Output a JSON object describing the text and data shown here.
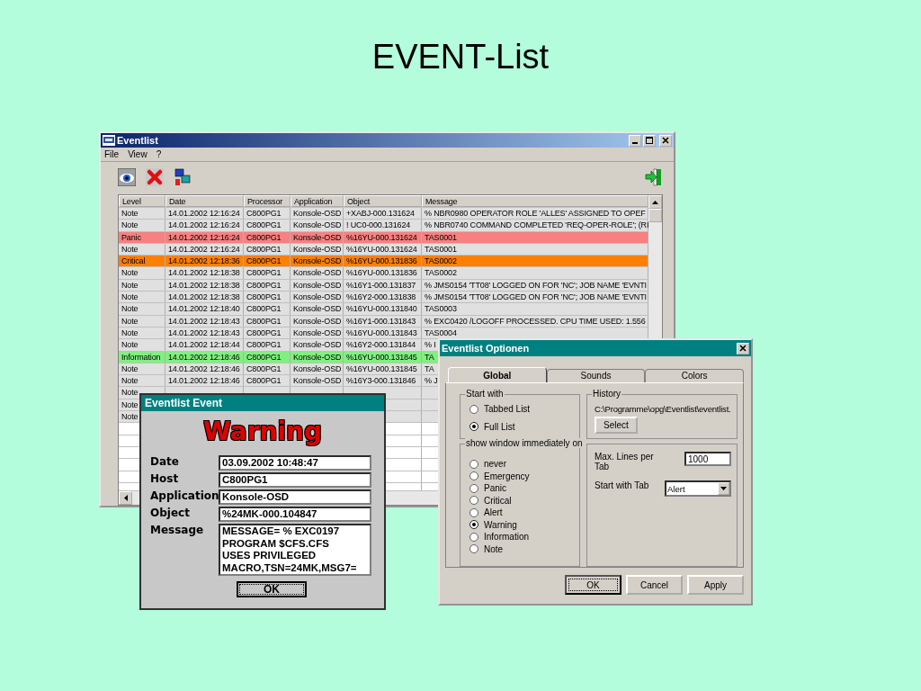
{
  "slide_title": "EVENT-List",
  "main_window": {
    "title": "Eventlist",
    "menu": [
      "File",
      "View",
      "?"
    ],
    "table": {
      "columns": [
        "Level",
        "Date",
        "Processor",
        "Application",
        "Object",
        "Message"
      ],
      "rows": [
        {
          "color": "#e0e0e0",
          "cells": [
            "Note",
            "14.01.2002 12:16:24",
            "C800PG1",
            "Konsole-OSD",
            "+XABJ-000.131624",
            "% NBR0980 OPERATOR ROLE 'ALLES' ASSIGNED TO OPEF"
          ]
        },
        {
          "color": "#e0e0e0",
          "cells": [
            "Note",
            "14.01.2002 12:16:24",
            "C800PG1",
            "Konsole-OSD",
            "! UC0-000.131624",
            "% NBR0740 COMMAND COMPLETED 'REQ-OPER-ROLE'; (RI"
          ]
        },
        {
          "color": "#f88080",
          "cells": [
            "Panic",
            "14.01.2002 12:16:24",
            "C800PG1",
            "Konsole-OSD",
            "%16YU-000.131624",
            "TAS0001"
          ]
        },
        {
          "color": "#e0e0e0",
          "cells": [
            "Note",
            "14.01.2002 12:16:24",
            "C800PG1",
            "Konsole-OSD",
            "%16YU-000.131624",
            "TAS0001"
          ]
        },
        {
          "color": "#ff8000",
          "cells": [
            "Critical",
            "14.01.2002 12:18:36",
            "C800PG1",
            "Konsole-OSD",
            "%16YU-000.131836",
            "TAS0002"
          ]
        },
        {
          "color": "#e0e0e0",
          "cells": [
            "Note",
            "14.01.2002 12:18:38",
            "C800PG1",
            "Konsole-OSD",
            "%16YU-000.131836",
            "TAS0002"
          ]
        },
        {
          "color": "#e0e0e0",
          "cells": [
            "Note",
            "14.01.2002 12:18:38",
            "C800PG1",
            "Konsole-OSD",
            "%16Y1-000.131837",
            "% JMS0154 'TT08' LOGGED ON FOR 'NC'; JOB NAME 'EVNTI"
          ]
        },
        {
          "color": "#e0e0e0",
          "cells": [
            "Note",
            "14.01.2002 12:18:38",
            "C800PG1",
            "Konsole-OSD",
            "%16Y2-000.131838",
            "% JMS0154 'TT08' LOGGED ON FOR 'NC'; JOB NAME 'EVNTI"
          ]
        },
        {
          "color": "#e0e0e0",
          "cells": [
            "Note",
            "14.01.2002 12:18:40",
            "C800PG1",
            "Konsole-OSD",
            "%16YU-000.131840",
            "TAS0003"
          ]
        },
        {
          "color": "#e0e0e0",
          "cells": [
            "Note",
            "14.01.2002 12:18:43",
            "C800PG1",
            "Konsole-OSD",
            "%16Y1-000.131843",
            "% EXC0420 /LOGOFF PROCESSED. CPU TIME USED: 1.556"
          ]
        },
        {
          "color": "#e0e0e0",
          "cells": [
            "Note",
            "14.01.2002 12:18:43",
            "C800PG1",
            "Konsole-OSD",
            "%16YU-000.131843",
            "TAS0004"
          ]
        },
        {
          "color": "#e0e0e0",
          "cells": [
            "Note",
            "14.01.2002 12:18:44",
            "C800PG1",
            "Konsole-OSD",
            "%16Y2-000.131844",
            "% I"
          ]
        },
        {
          "color": "#80f080",
          "cells": [
            "Information",
            "14.01.2002 12:18:46",
            "C800PG1",
            "Konsole-OSD",
            "%16YU-000.131845",
            "TA"
          ]
        },
        {
          "color": "#e0e0e0",
          "cells": [
            "Note",
            "14.01.2002 12:18:46",
            "C800PG1",
            "Konsole-OSD",
            "%16YU-000.131845",
            "TA"
          ]
        },
        {
          "color": "#e0e0e0",
          "cells": [
            "Note",
            "14.01.2002 12:18:46",
            "C800PG1",
            "Konsole-OSD",
            "%16Y3-000.131846",
            "% J"
          ]
        },
        {
          "color": "#e0e0e0",
          "cells": [
            "Note"
          ]
        },
        {
          "color": "#e0e0e0",
          "cells": [
            "Note"
          ]
        },
        {
          "color": "#e0e0e0",
          "cells": [
            "Note"
          ]
        }
      ]
    }
  },
  "event_dialog": {
    "title": "Eventlist Event",
    "heading": "Warning",
    "fields": [
      {
        "label": "Date",
        "lines": [
          "03.09.2002 10:48:47"
        ]
      },
      {
        "label": "Host",
        "lines": [
          "C800PG1"
        ]
      },
      {
        "label": "Application",
        "lines": [
          "Konsole-OSD"
        ]
      },
      {
        "label": "Object",
        "lines": [
          "%24MK-000.104847"
        ]
      },
      {
        "label": "Message",
        "lines": [
          "MESSAGE= %  EXC0197",
          "PROGRAM $CFS.CFS",
          "USES PRIVILEGED",
          "MACRO,TSN=24MK,MSG7="
        ]
      }
    ],
    "button": "OK"
  },
  "options_dialog": {
    "title": "Eventlist Optionen",
    "tabs": [
      {
        "label": "Global",
        "selected": true
      },
      {
        "label": "Sounds",
        "selected": false
      },
      {
        "label": "Colors",
        "selected": false
      }
    ],
    "start_with": {
      "legend": "Start with",
      "options": [
        {
          "label": "Tabbed List",
          "selected": false
        },
        {
          "label": "Full List",
          "selected": true
        }
      ]
    },
    "history": {
      "legend": "History",
      "path": "C:\\Programme\\opg\\Eventlist\\eventlist.",
      "button": "Select"
    },
    "show_window": {
      "legend": "show window immediately on",
      "options": [
        {
          "label": "never",
          "selected": false
        },
        {
          "label": "Emergency",
          "selected": false
        },
        {
          "label": "Panic",
          "selected": false
        },
        {
          "label": "Critical",
          "selected": false
        },
        {
          "label": "Alert",
          "selected": false
        },
        {
          "label": "Warning",
          "selected": true
        },
        {
          "label": "Information",
          "selected": false
        },
        {
          "label": "Note",
          "selected": false
        }
      ]
    },
    "max_lines": {
      "label": "Max. Lines per Tab",
      "value": "1000"
    },
    "start_tab": {
      "label": "Start with Tab",
      "value": "Alert"
    },
    "buttons": [
      "OK",
      "Cancel",
      "Apply"
    ]
  }
}
